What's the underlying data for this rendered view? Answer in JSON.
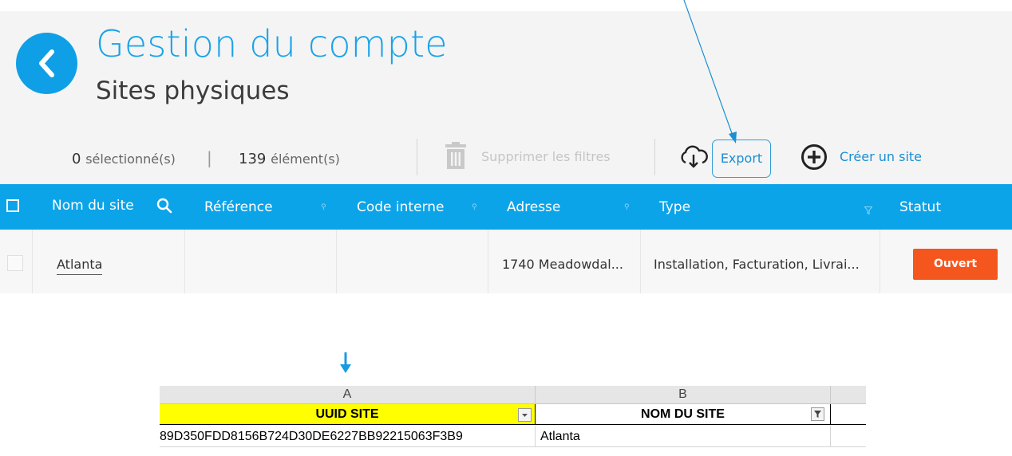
{
  "header": {
    "title": "Gestion du compte",
    "subtitle": "Sites physiques"
  },
  "toolbar": {
    "selected_count": "0",
    "selected_label": "sélectionné(s)",
    "separator": "|",
    "item_count": "139",
    "item_label": "élément(s)",
    "clear_filters_label": "Supprimer les filtres",
    "export_label": "Export",
    "create_site_label": "Créer un site"
  },
  "table": {
    "columns": [
      "Nom du site",
      "Référence",
      "Code interne",
      "Adresse",
      "Type",
      "Statut"
    ],
    "rows": [
      {
        "name": "Atlanta",
        "reference": "",
        "internal_code": "",
        "address": "1740 Meadowdal...",
        "type": "Installation, Facturation, Livrai...",
        "status": "Ouvert"
      }
    ]
  },
  "spreadsheet": {
    "column_letters": [
      "A",
      "B"
    ],
    "headers": [
      "UUID SITE",
      "NOM DU SITE"
    ],
    "rows": [
      [
        "89D350FDD8156B724D30DE6227BB92215063F3B9",
        "Atlanta"
      ]
    ]
  },
  "colors": {
    "accent": "#0ba4e9",
    "title_blue": "#1aa3e8",
    "status_open": "#f5561e",
    "uuid_header_fill": "#ffff00",
    "annotation_arrow": "#1a8fd3"
  },
  "icons": [
    "chevron-left-icon",
    "trash-icon",
    "cloud-download-icon",
    "plus-circle-icon",
    "search-icon",
    "filter-icon",
    "arrow-down-icon"
  ]
}
